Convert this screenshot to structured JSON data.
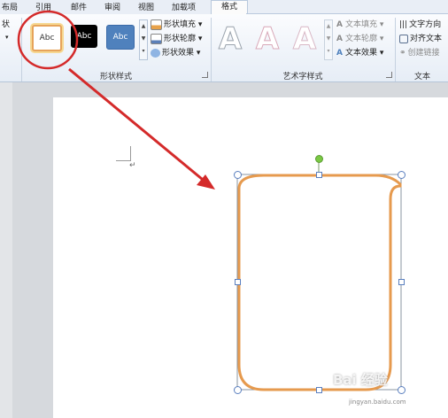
{
  "tabs": {
    "items": [
      "布局",
      "引用",
      "邮件",
      "审阅",
      "视图",
      "加载项"
    ],
    "active": "格式"
  },
  "ribbon": {
    "left_partial": [
      "状",
      "▾"
    ],
    "shape_styles": {
      "group_label": "形状样式",
      "presets": [
        {
          "label": "Abc",
          "fill": "#ffffff",
          "border": "#e6a35a",
          "text_color": "#333333"
        },
        {
          "label": "Abc",
          "fill": "#000000",
          "border": "#000000",
          "text_color": "#ffffff"
        },
        {
          "label": "Abc",
          "fill": "#4f81bd",
          "border": "#3a6aa8",
          "text_color": "#ffffff"
        }
      ],
      "fill_label": "形状填充",
      "outline_label": "形状轮廓",
      "effects_label": "形状效果"
    },
    "wordart_styles": {
      "group_label": "艺术字样式",
      "letters": [
        "A",
        "A",
        "A"
      ],
      "text_fill_label": "文本填充",
      "text_outline_label": "文本轮廓",
      "text_effects_label": "文本效果"
    },
    "text_group": {
      "group_label": "文本",
      "direction_label": "文字方向",
      "align_label": "对齐文本",
      "link_label": "创建链接"
    }
  },
  "document": {
    "paragraph_mark": "↵"
  },
  "watermark": "Bai 经验",
  "watermark_sub": "jingyan.baidu.com",
  "colors": {
    "highlight_circle": "#d42a2a",
    "arrow": "#d42a2a",
    "shape_outline": "#e69a4e",
    "rotate_handle": "#7ac943"
  }
}
